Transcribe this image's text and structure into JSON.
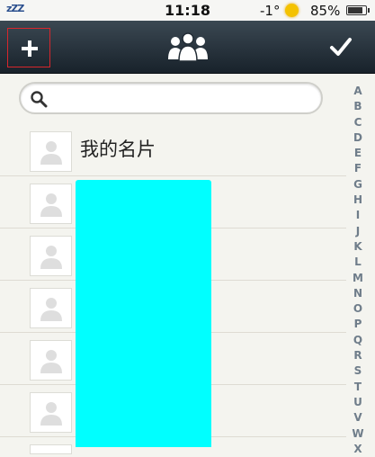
{
  "status_bar": {
    "sleep_text": "zZZ",
    "time": "11:18",
    "temperature": "-1°",
    "battery_text": "85%",
    "battery_level": 0.85
  },
  "nav": {
    "add_icon": "plus-icon",
    "title_icon": "group-icon",
    "done_icon": "checkmark-icon"
  },
  "search": {
    "icon": "search-icon",
    "value": "",
    "placeholder": ""
  },
  "contacts": [
    {
      "name": "我的名片"
    },
    {
      "name": ""
    },
    {
      "name": ""
    },
    {
      "name": ""
    },
    {
      "name": ""
    },
    {
      "name": ""
    }
  ],
  "index_letters": [
    "A",
    "B",
    "C",
    "D",
    "E",
    "F",
    "G",
    "H",
    "I",
    "J",
    "K",
    "L",
    "M",
    "N",
    "O",
    "P",
    "Q",
    "R",
    "S",
    "T",
    "U",
    "V",
    "W",
    "X"
  ],
  "colors": {
    "nav_top": "#3b4852",
    "nav_bottom": "#18222b",
    "highlight_border": "#d7262c",
    "redaction": "#00ffff",
    "index_text": "#6f7d8a"
  }
}
